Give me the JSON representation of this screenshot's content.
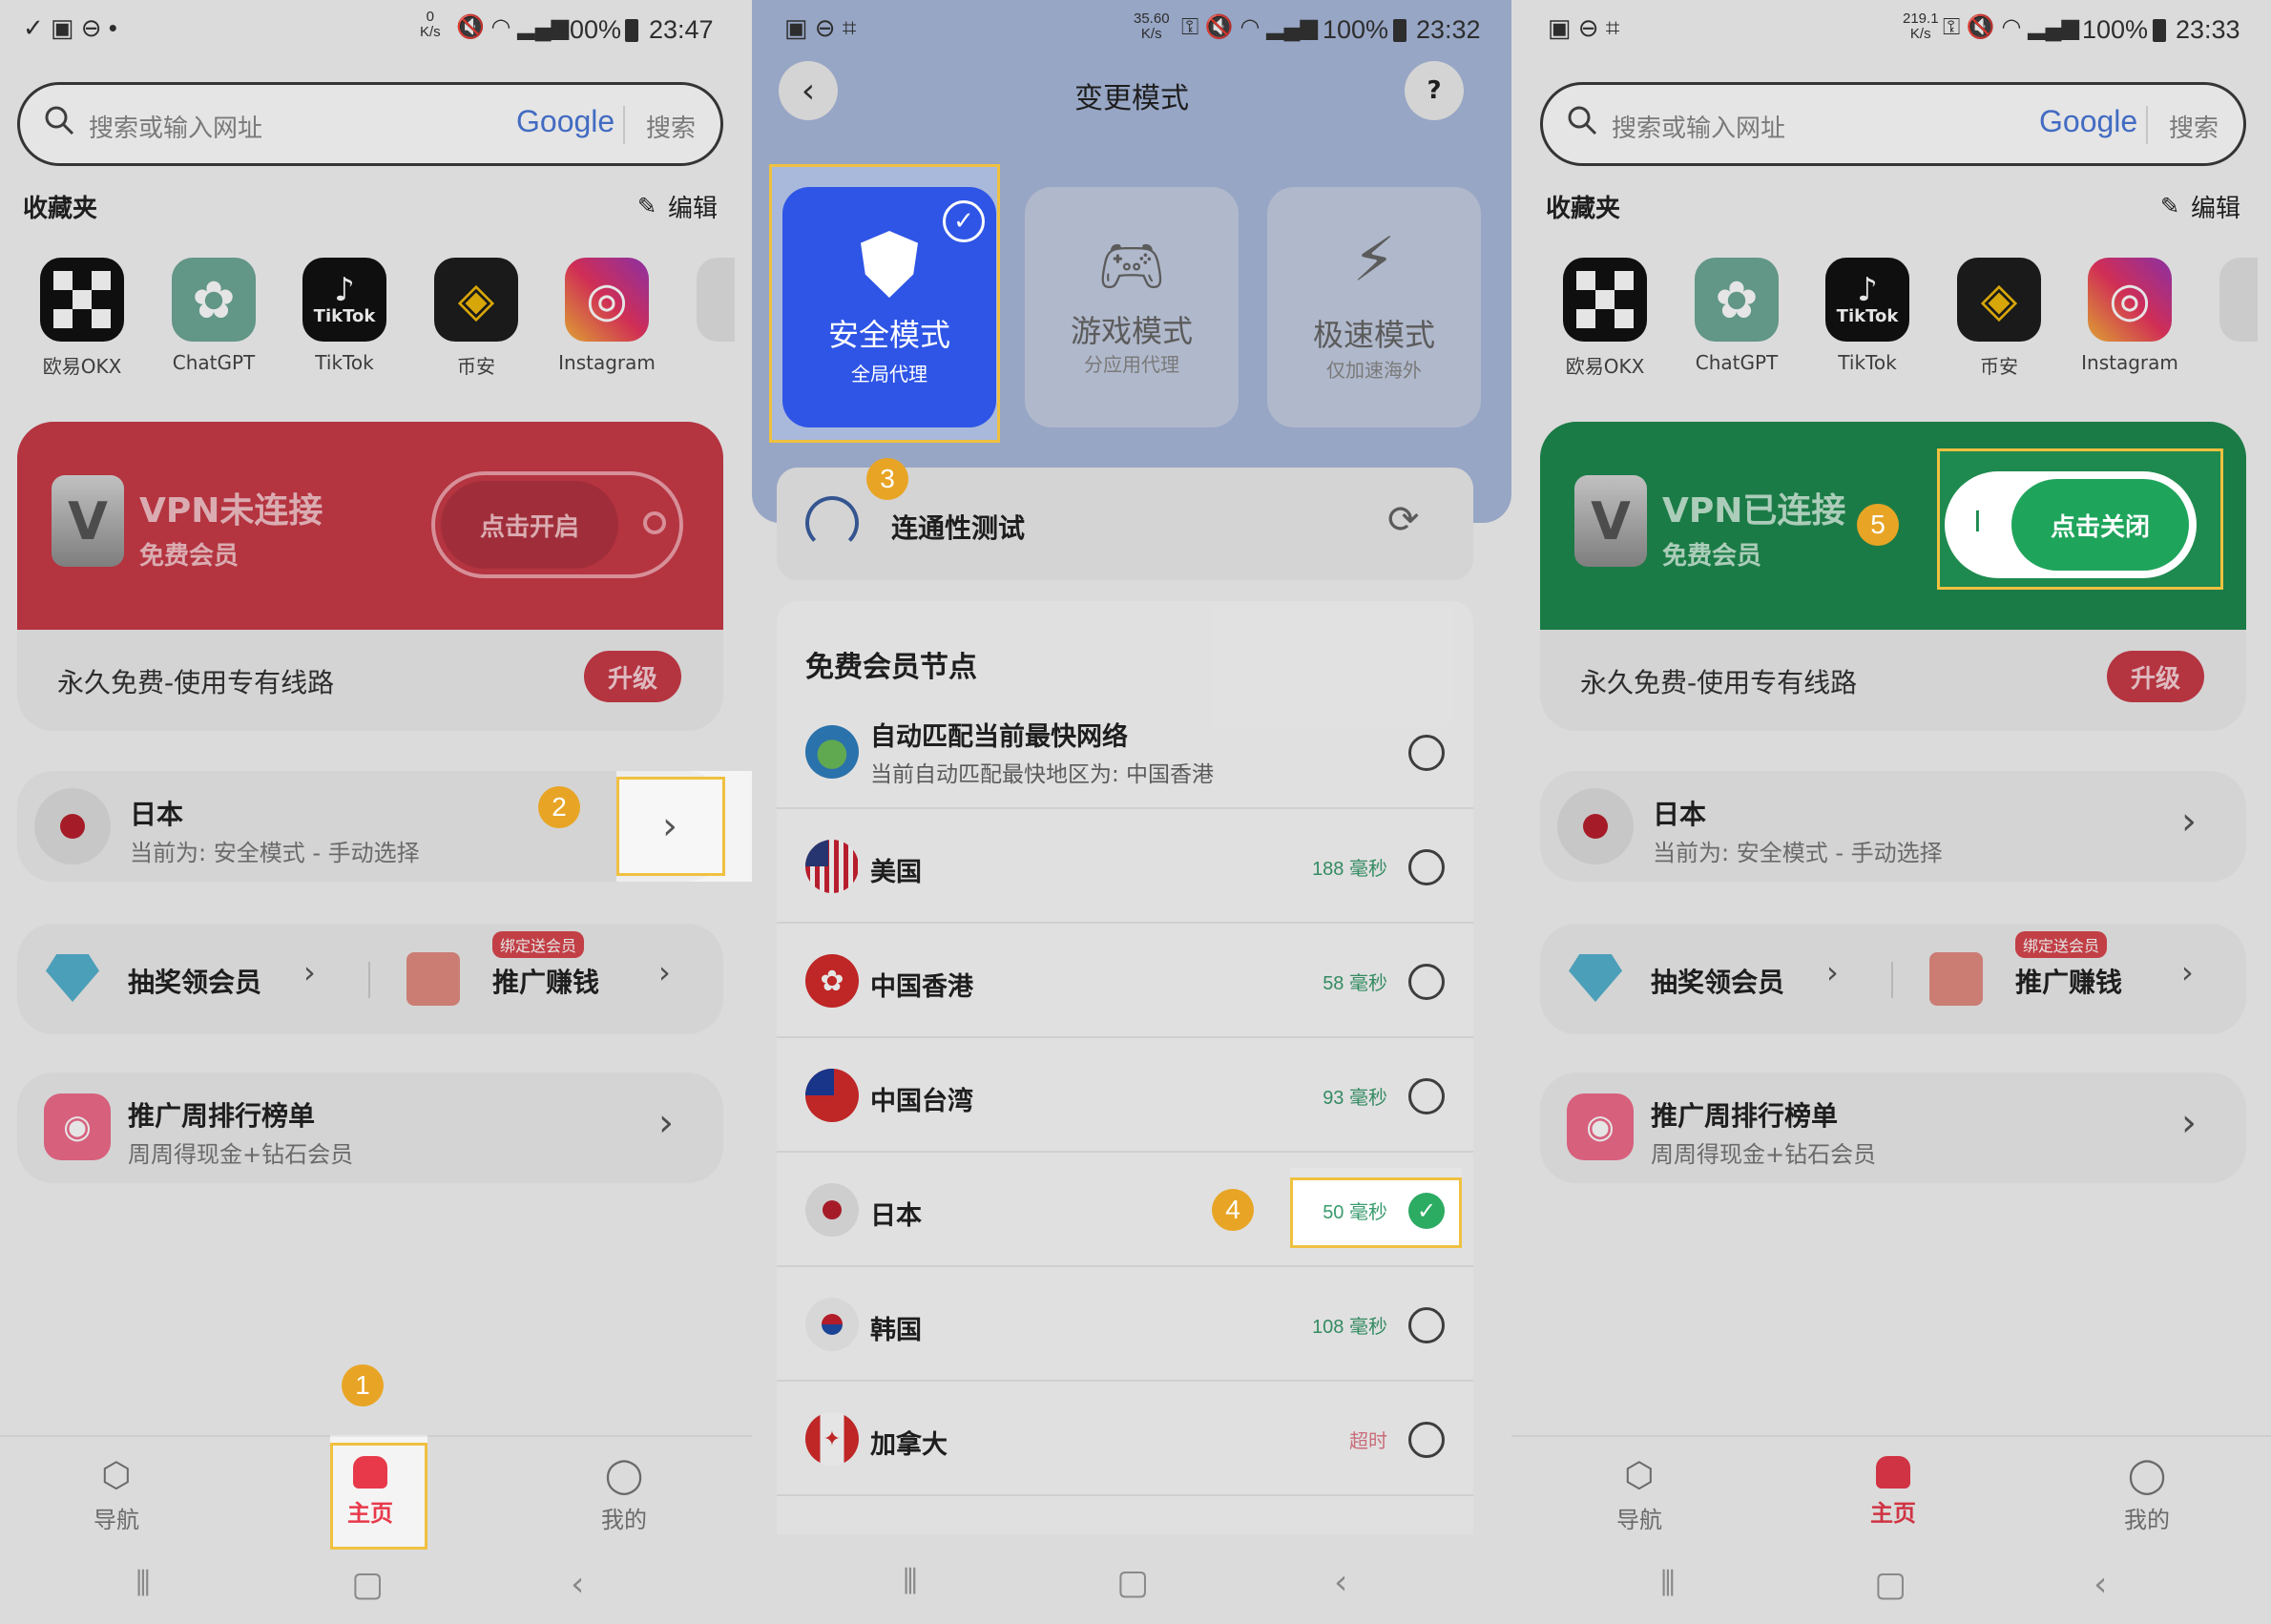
{
  "panel1": {
    "status": {
      "left_icons": "✓ ▣ ⊖ •",
      "speed_top": "0",
      "speed_unit": "K/s",
      "battery": "100%",
      "time": "23:47"
    },
    "search": {
      "placeholder": "搜索或输入网址",
      "engine": "Google",
      "button": "搜索"
    },
    "favorites": {
      "title": "收藏夹",
      "edit": "编辑",
      "items": [
        {
          "label": "欧易OKX"
        },
        {
          "label": "ChatGPT"
        },
        {
          "label": "TikTok",
          "tile_text": "TikTok"
        },
        {
          "label": "币安"
        },
        {
          "label": "Instagram"
        }
      ]
    },
    "vpn": {
      "title": "VPN未连接",
      "subtitle": "免费会员",
      "toggle": "点击开启",
      "footer": "永久免费-使用专有线路",
      "upgrade": "升级"
    },
    "location": {
      "name": "日本",
      "detail": "当前为: 安全模式 - 手动选择"
    },
    "promo": {
      "lottery": "抽奖领会员",
      "promote": "推广赚钱",
      "promote_tag": "绑定送会员"
    },
    "ranking": {
      "title": "推广周排行榜单",
      "subtitle": "周周得现金+钻石会员"
    },
    "nav": {
      "guide": "导航",
      "home": "主页",
      "mine": "我的"
    },
    "badges": {
      "b1": "1",
      "b2": "2"
    }
  },
  "panel2": {
    "status": {
      "speed_top": "35.60",
      "speed_unit": "K/s",
      "battery": "100%",
      "time": "23:32"
    },
    "header": {
      "title": "变更模式",
      "help": "?"
    },
    "modes": [
      {
        "title": "安全模式",
        "subtitle": "全局代理"
      },
      {
        "title": "游戏模式",
        "subtitle": "分应用代理"
      },
      {
        "title": "极速模式",
        "subtitle": "仅加速海外"
      }
    ],
    "connectivity": "连通性测试",
    "nodes_title": "免费会员节点",
    "nodes": [
      {
        "name": "自动匹配当前最快网络",
        "detail": "当前自动匹配最快地区为: 中国香港",
        "latency": ""
      },
      {
        "name": "美国",
        "latency": "188 毫秒"
      },
      {
        "name": "中国香港",
        "latency": "58 毫秒"
      },
      {
        "name": "中国台湾",
        "latency": "93 毫秒"
      },
      {
        "name": "日本",
        "latency": "50 毫秒"
      },
      {
        "name": "韩国",
        "latency": "108 毫秒"
      },
      {
        "name": "加拿大",
        "latency": "超时"
      }
    ],
    "badges": {
      "b3": "3",
      "b4": "4"
    }
  },
  "panel3": {
    "status": {
      "speed_top": "219.1",
      "speed_unit": "K/s",
      "battery": "100%",
      "time": "23:33"
    },
    "search": {
      "placeholder": "搜索或输入网址",
      "engine": "Google",
      "button": "搜索"
    },
    "favorites": {
      "title": "收藏夹",
      "edit": "编辑",
      "items": [
        {
          "label": "欧易OKX"
        },
        {
          "label": "ChatGPT"
        },
        {
          "label": "TikTok",
          "tile_text": "TikTok"
        },
        {
          "label": "币安"
        },
        {
          "label": "Instagram"
        }
      ]
    },
    "vpn": {
      "title": "VPN已连接",
      "subtitle": "免费会员",
      "toggle": "点击关闭",
      "toggle_left": "I",
      "footer": "永久免费-使用专有线路",
      "upgrade": "升级"
    },
    "location": {
      "name": "日本",
      "detail": "当前为: 安全模式 - 手动选择"
    },
    "promo": {
      "lottery": "抽奖领会员",
      "promote": "推广赚钱",
      "promote_tag": "绑定送会员"
    },
    "ranking": {
      "title": "推广周排行榜单",
      "subtitle": "周周得现金+钻石会员"
    },
    "nav": {
      "guide": "导航",
      "home": "主页",
      "mine": "我的"
    },
    "badges": {
      "b5": "5"
    }
  },
  "colors": {
    "vpn_off": "#c93a48",
    "vpn_on": "#1f8a4f",
    "mode_active": "#2f55e6",
    "accent_red": "#e8394b",
    "badge": "#e8a525"
  }
}
